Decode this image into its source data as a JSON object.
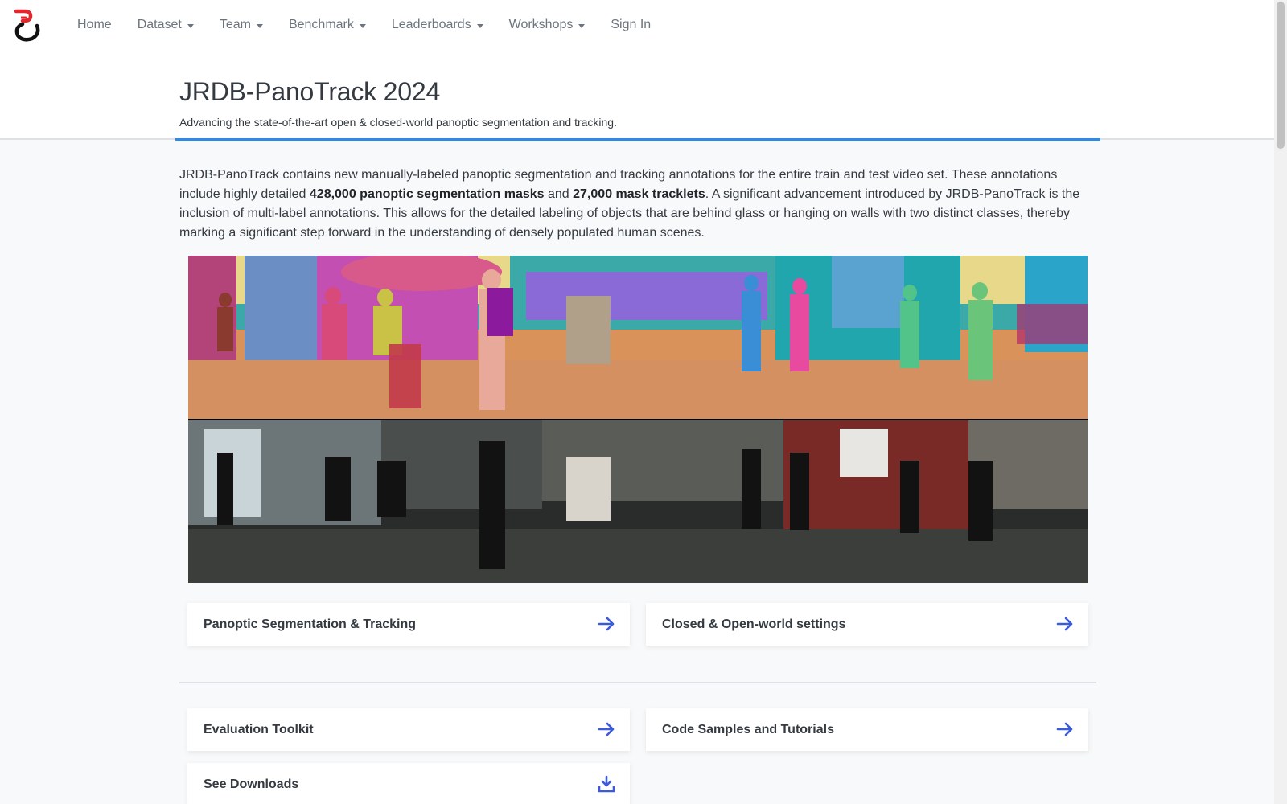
{
  "nav": {
    "items": [
      {
        "label": "Home",
        "dropdown": false
      },
      {
        "label": "Dataset",
        "dropdown": true
      },
      {
        "label": "Team",
        "dropdown": true
      },
      {
        "label": "Benchmark",
        "dropdown": true
      },
      {
        "label": "Leaderboards",
        "dropdown": true
      },
      {
        "label": "Workshops",
        "dropdown": true
      },
      {
        "label": "Sign In",
        "dropdown": false
      }
    ]
  },
  "header": {
    "title": "JRDB-PanoTrack 2024",
    "subtitle": "Advancing the state-of-the-art open & closed-world panoptic segmentation and tracking."
  },
  "intro": {
    "part1": "JRDB-PanoTrack contains new manually-labeled panoptic segmentation and tracking annotations for the entire train and test video set. These annotations include highly detailed ",
    "bold1": "428,000 panoptic segmentation masks",
    "part2": " and ",
    "bold2": "27,000 mask tracklets",
    "part3": ". A significant advancement introduced by JRDB-PanoTrack is the inclusion of multi-label annotations. This allows for the detailed labeling of objects that are behind glass or hanging on walls with two distinct classes, thereby marking a significant step forward in the understanding of densely populated human scenes."
  },
  "cards": {
    "panoptic": {
      "label": "Panoptic Segmentation & Tracking",
      "icon": "arrow-right-icon"
    },
    "closed_open": {
      "label": "Closed & Open-world settings",
      "icon": "arrow-right-icon"
    },
    "toolkit": {
      "label": "Evaluation Toolkit",
      "icon": "arrow-right-icon"
    },
    "tutorials": {
      "label": "Code Samples and Tutorials",
      "icon": "arrow-right-icon"
    },
    "downloads": {
      "label": "See Downloads",
      "icon": "download-icon"
    }
  },
  "colors": {
    "accent": "#2d8be6",
    "icon": "#3b5bdb",
    "logo_red": "#e0282e"
  }
}
